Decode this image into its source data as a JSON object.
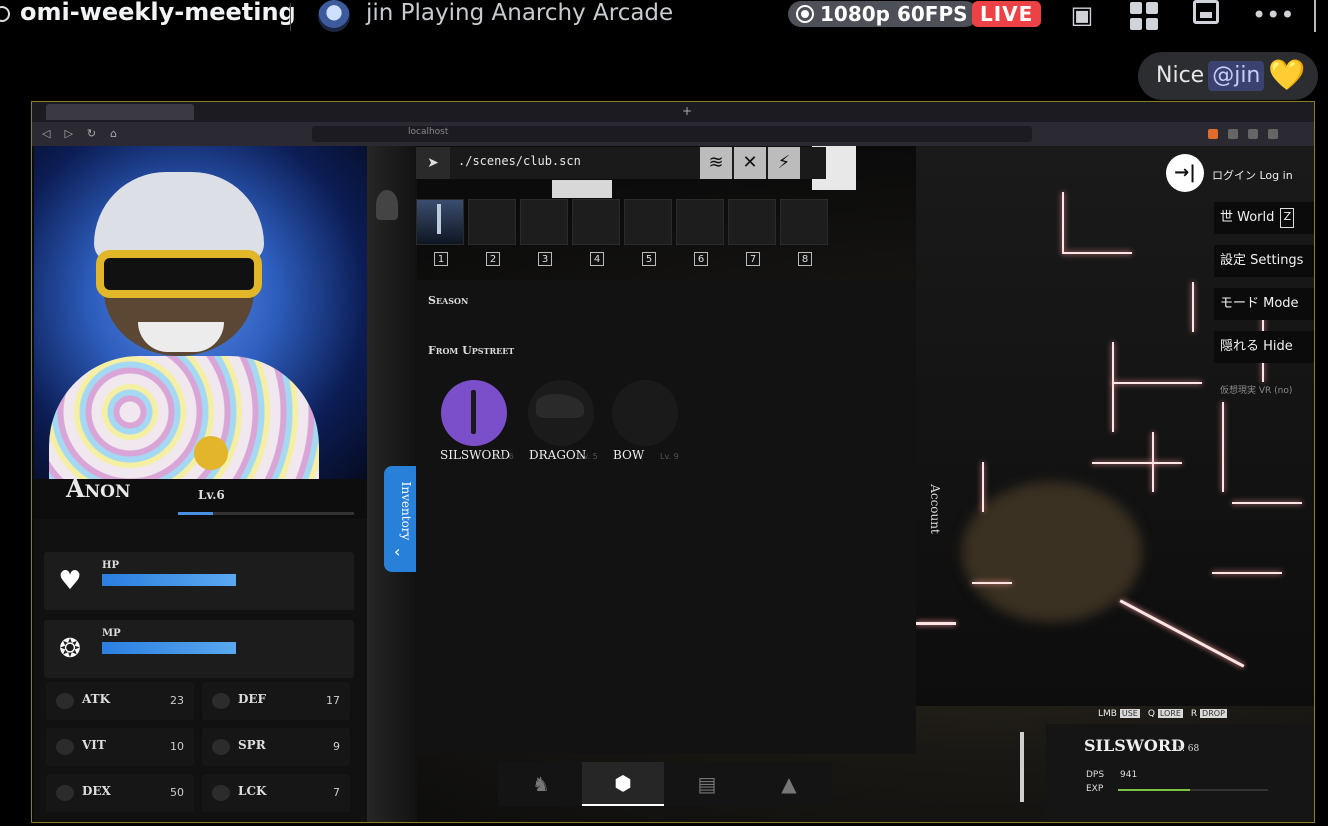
{
  "stream_header": {
    "channel": "omi-weekly-meeting",
    "streamer_text": "jin Playing Anarchy Arcade",
    "quality": "1080p 60FPS",
    "live": "LIVE"
  },
  "chat": {
    "text": "Nice",
    "mention": "@jin",
    "emoji": "💛"
  },
  "browser": {
    "url": "localhost"
  },
  "game": {
    "scene_path": "./scenes/club.scn",
    "hotbar_slots": [
      "1",
      "2",
      "3",
      "4",
      "5",
      "6",
      "7",
      "8"
    ],
    "character": {
      "name": "Anon",
      "level": "Lv.6",
      "xp_fraction": 0.2,
      "hp_label": "HP",
      "hp_fraction": 1.0,
      "mp_label": "MP",
      "mp_fraction": 1.0,
      "stats": [
        {
          "key": "ATK",
          "value": "23"
        },
        {
          "key": "DEF",
          "value": "17"
        },
        {
          "key": "VIT",
          "value": "10"
        },
        {
          "key": "SPR",
          "value": "9"
        },
        {
          "key": "DEX",
          "value": "50"
        },
        {
          "key": "LCK",
          "value": "7"
        }
      ]
    },
    "inventory": {
      "tab_label": "Inventory",
      "section_season": "Season",
      "section_upstreet": "From Upstreet",
      "items": [
        {
          "name": "SILSWORD",
          "level": "Lv. 6"
        },
        {
          "name": "DRAGON",
          "level": "Lv. 5"
        },
        {
          "name": "BOW",
          "level": "Lv. 9"
        }
      ]
    },
    "account_label": "Account",
    "menu": {
      "login": "ログイン Log in",
      "world": "世 World",
      "world_key": "Z",
      "settings": "設定 Settings",
      "mode": "モード Mode",
      "hide": "隠れる Hide",
      "vr": "仮想現実 VR (no)"
    },
    "hud": {
      "keys": [
        {
          "key": "LMB",
          "action": "USE"
        },
        {
          "key": "Q",
          "action": "LORE"
        },
        {
          "key": "R",
          "action": "DROP"
        }
      ],
      "weapon_name": "SILSWORD",
      "weapon_level": "Lv. 68",
      "dps_label": "DPS",
      "dps_value": "941",
      "exp_label": "EXP",
      "exp_fraction": 0.48
    }
  }
}
